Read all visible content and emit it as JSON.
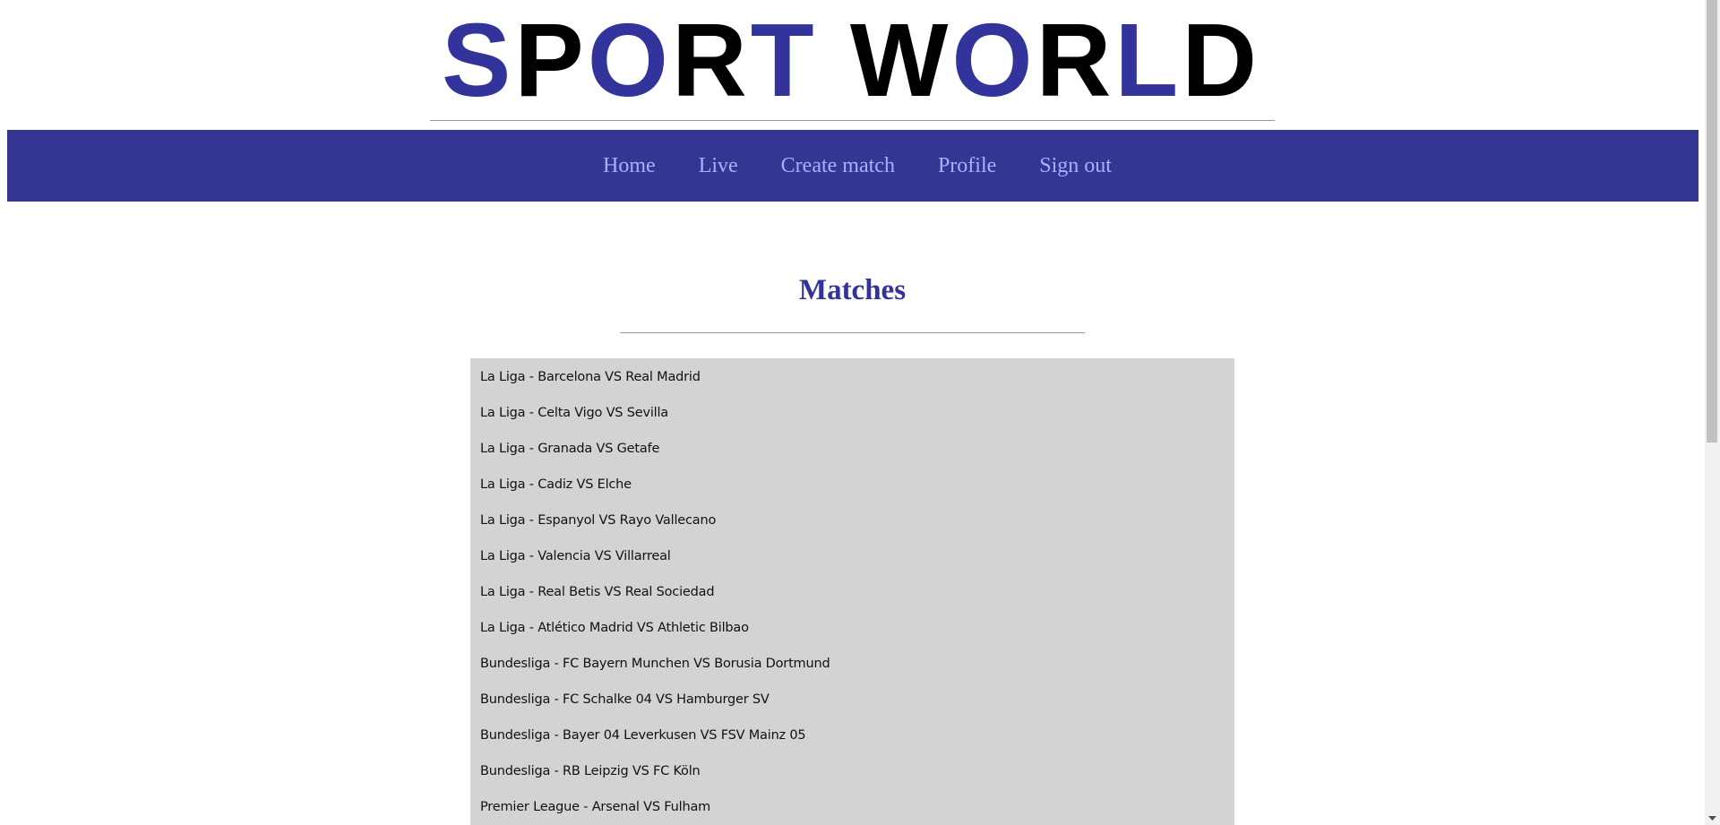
{
  "logo": {
    "word1": "SPORT",
    "word2": "WORLD",
    "colors": {
      "blue": "#32339b",
      "black": "#000000"
    }
  },
  "nav": {
    "background": "#353593",
    "link_color": "#a8b0ff",
    "items": [
      {
        "label": "Home"
      },
      {
        "label": "Live"
      },
      {
        "label": "Create match"
      },
      {
        "label": "Profile"
      },
      {
        "label": "Sign out"
      }
    ]
  },
  "main": {
    "title": "Matches",
    "title_color": "#32339b",
    "list_background": "#d3d3d3",
    "matches": [
      "La Liga - Barcelona VS Real Madrid",
      "La Liga - Celta Vigo VS Sevilla",
      "La Liga - Granada VS Getafe",
      "La Liga - Cadiz VS Elche",
      "La Liga - Espanyol VS Rayo Vallecano",
      "La Liga - Valencia VS Villarreal",
      "La Liga - Real Betis VS Real Sociedad",
      "La Liga - Atlético Madrid VS Athletic Bilbao",
      "Bundesliga - FC Bayern Munchen VS Borusia Dortmund",
      "Bundesliga - FC Schalke 04 VS Hamburger SV",
      "Bundesliga - Bayer 04 Leverkusen VS FSV Mainz 05",
      "Bundesliga - RB Leipzig VS FC Köln",
      "Premier League - Arsenal VS Fulham"
    ]
  }
}
